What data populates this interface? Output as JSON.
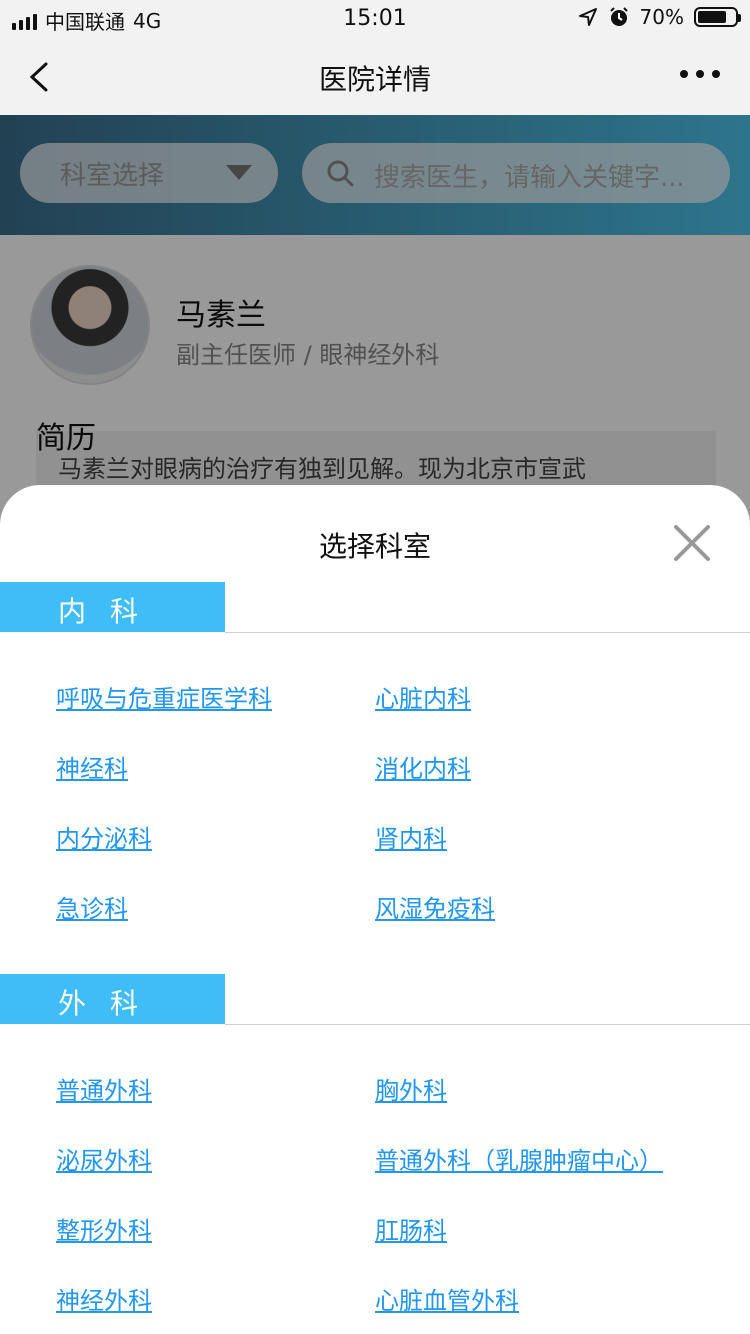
{
  "status_bar": {
    "carrier": "中国联通",
    "network": "4G",
    "time": "15:01",
    "battery": "70%"
  },
  "nav": {
    "title": "医院详情"
  },
  "search_bar": {
    "dept_select_label": "科室选择",
    "search_placeholder": "搜索医生，请输入关键字..."
  },
  "doctor": {
    "name": "马素兰",
    "meta": "副主任医师   /   眼神经外科",
    "resume_title": "简历",
    "resume_text": "马素兰对眼病的治疗有独到见解。现为北京市宣武"
  },
  "sheet": {
    "title": "选择科室",
    "categories": [
      {
        "name": "内科",
        "departments": [
          "呼吸与危重症医学科",
          "心脏内科",
          "神经科",
          "消化内科",
          "内分泌科",
          "肾内科",
          "急诊科",
          "风湿免疫科"
        ]
      },
      {
        "name": "外科",
        "departments": [
          "普通外科",
          "胸外科",
          "泌尿外科",
          "普通外科（乳腺肿瘤中心）",
          "整形外科",
          "肛肠科",
          "神经外科",
          "心脏血管外科"
        ]
      }
    ]
  },
  "colors": {
    "accent": "#3ebdf6",
    "link": "#2196f3"
  }
}
